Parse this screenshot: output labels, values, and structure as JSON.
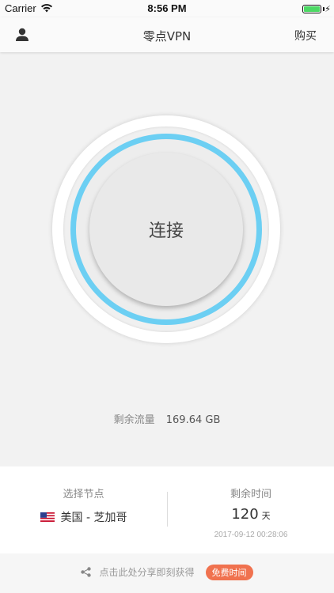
{
  "status_bar": {
    "carrier": "Carrier",
    "time": "8:56 PM"
  },
  "nav": {
    "title": "零点VPN",
    "buy_label": "购买"
  },
  "connect": {
    "label": "连接",
    "ring_color": "#6ccff3"
  },
  "traffic": {
    "label": "剩余流量",
    "value": "169.64 GB"
  },
  "node": {
    "label": "选择节点",
    "flag": "us-flag-icon",
    "value": "美国 - 芝加哥"
  },
  "remaining_time": {
    "label": "剩余时间",
    "value": "120",
    "unit": "天",
    "expiry": "2017-09-12 00:28:06"
  },
  "share": {
    "text": "点击此处分享即刻获得",
    "badge": "免费时间",
    "badge_color": "#f0724f"
  }
}
